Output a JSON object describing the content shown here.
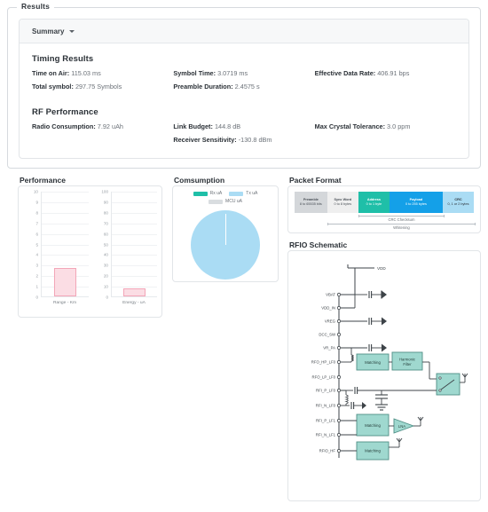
{
  "window": {
    "legend": "Results"
  },
  "summary": {
    "toggle_label": "Summary",
    "caret_icon": "chevron-down-icon",
    "timing": {
      "title": "Timing Results",
      "items": [
        {
          "key": "Time on Air:",
          "value": "115.03 ms"
        },
        {
          "key": "Symbol Time:",
          "value": "3.0719 ms"
        },
        {
          "key": "Effective Data Rate:",
          "value": "406.91 bps"
        },
        {
          "key": "Total symbol:",
          "value": "297.75 Symbols"
        },
        {
          "key": "Preamble Duration:",
          "value": "2.4575 s"
        },
        {
          "key": "",
          "value": ""
        }
      ]
    },
    "rf": {
      "title": "RF Performance",
      "items": [
        {
          "key": "Radio Consumption:",
          "value": "7.92 uAh"
        },
        {
          "key": "Link Budget:",
          "value": "144.8 dB"
        },
        {
          "key": "Max Crystal Tolerance:",
          "value": "3.0 ppm"
        },
        {
          "key": "",
          "value": ""
        },
        {
          "key": "Receiver Sensitivity:",
          "value": "-130.8 dBm"
        },
        {
          "key": "",
          "value": ""
        }
      ]
    }
  },
  "performance": {
    "title": "Performance"
  },
  "consumption": {
    "title": "Comsumption",
    "legend": [
      {
        "label": "Rx uA",
        "color": "#1fbfa8"
      },
      {
        "label": "Tx uA",
        "color": "#aadcf4"
      },
      {
        "label": "MCU uA",
        "color": "#d9dde0"
      }
    ]
  },
  "packet_format": {
    "title": "Packet Format",
    "fields": [
      {
        "name": "Preamble",
        "size": "8 to 65535 bits",
        "color": "#d4d7da",
        "text": "#4a5057",
        "flex": 1.05
      },
      {
        "name": "Sync Word",
        "size": "0 to 8 bytes",
        "color": "#efefef",
        "text": "#4a5057",
        "flex": 1.0
      },
      {
        "name": "Address",
        "size": "0 to 1 byte",
        "color": "#1fbfa8",
        "text": "#ffffff",
        "flex": 1.0
      },
      {
        "name": "Payload",
        "size": "0 to 255 bytes",
        "color": "#14a0e8",
        "text": "#ffffff",
        "flex": 1.75
      },
      {
        "name": "CRC",
        "size": "0, 1 or 2 bytes",
        "color": "#aadcf4",
        "text": "#2b3137",
        "flex": 1.0
      }
    ],
    "annotations": [
      {
        "label": "CRC Checksum"
      },
      {
        "label": "Whitening"
      }
    ]
  },
  "rfio": {
    "title": "RFIO Schematic",
    "supply_label": "VDD",
    "pins": [
      "VBAT",
      "VDD_IN",
      "VREG",
      "DCC_SW",
      "VR_PA",
      "RFO_HP_LF0",
      "RFO_LP_LF0",
      "RFI_P_LF0",
      "RFI_N_LF0",
      "RFI_P_LF1",
      "RFI_N_LF1",
      "RFIO_HF"
    ],
    "blocks": [
      {
        "label": "Matching"
      },
      {
        "label": "Harmonic Filter"
      },
      {
        "label": "Matching"
      },
      {
        "label": "Matching"
      }
    ],
    "lna_label": "LNA"
  },
  "chart_data": [
    {
      "type": "bar",
      "title": "Performance",
      "panels": [
        {
          "categories": [
            "Range - Km"
          ],
          "values": [
            2.65
          ],
          "ylim": [
            0,
            10
          ],
          "yticks": [
            0,
            1,
            2,
            3,
            4,
            5,
            6,
            7,
            8,
            9,
            10
          ],
          "xlabel": "Range - Km",
          "ylabel": ""
        },
        {
          "categories": [
            "Energy - uA"
          ],
          "values": [
            7.9
          ],
          "ylim": [
            0,
            100
          ],
          "yticks": [
            0,
            10,
            20,
            30,
            40,
            50,
            60,
            70,
            80,
            90,
            100
          ],
          "xlabel": "Energy - uA",
          "ylabel": ""
        }
      ],
      "grid": true,
      "legend": "none",
      "bar_fill": "#fbdde4",
      "bar_stroke": "#f3a6b8"
    },
    {
      "type": "pie",
      "title": "Comsumption",
      "labels": [
        "Rx uA",
        "Tx uA",
        "MCU uA"
      ],
      "values": [
        0.0,
        99.9,
        0.1
      ],
      "colors": [
        "#1fbfa8",
        "#aadcf4",
        "#d9dde0"
      ],
      "legend": "top"
    }
  ]
}
